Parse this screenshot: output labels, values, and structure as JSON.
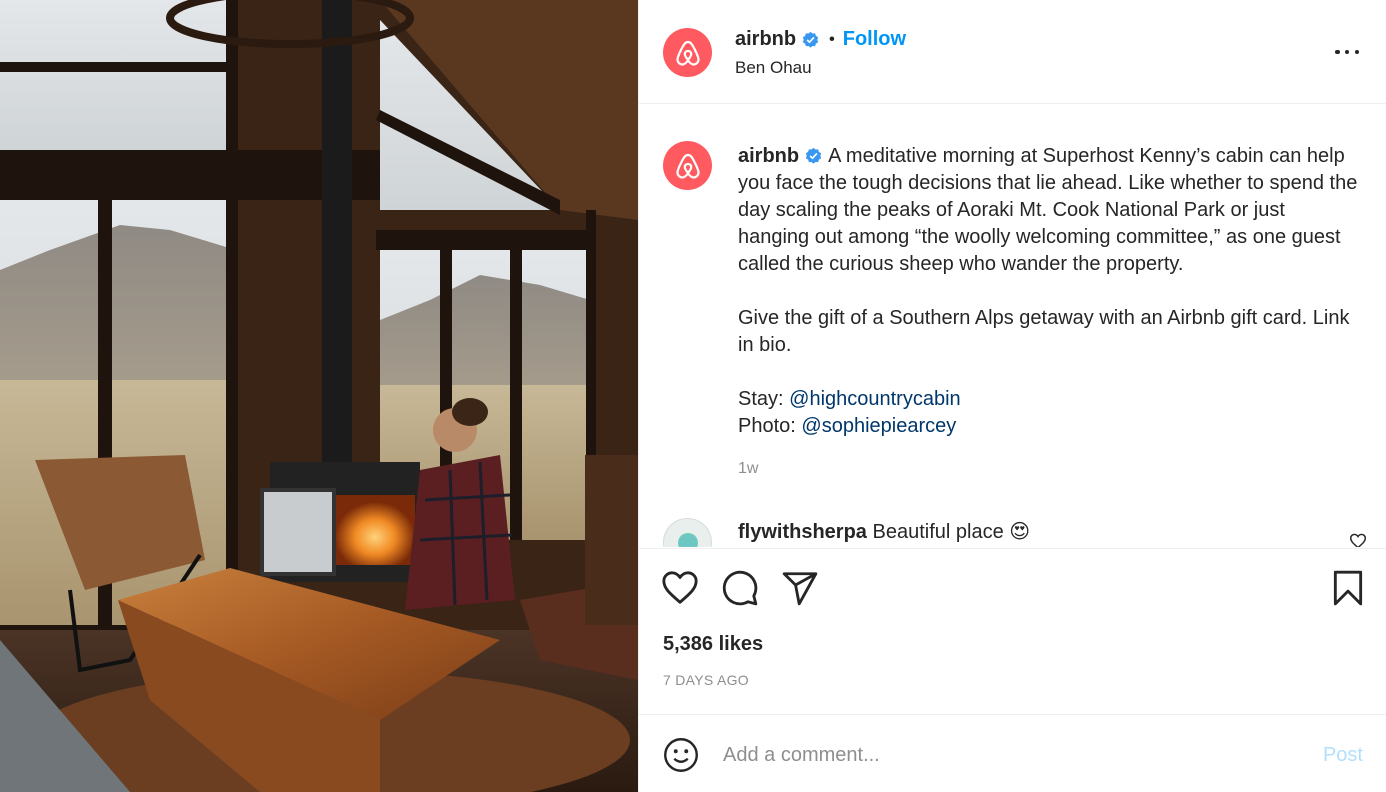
{
  "photo": {
    "alt_icon": "cabin-photo",
    "palette": {
      "wall": "#3a2416",
      "sky": "#d9dde0",
      "mountain": "#9a938a",
      "field": "#b9a888",
      "fire": "#f08a24",
      "table": "#b5662c",
      "rug": "#5a2e1f"
    }
  },
  "header": {
    "username": "airbnb",
    "separator": "•",
    "follow_label": "Follow",
    "location": "Ben Ohau",
    "more_icon": "more-horizontal-icon"
  },
  "caption": {
    "username": "airbnb",
    "text_1": "A meditative morning at Superhost Kenny’s cabin can help you face the tough decisions that lie ahead. Like whether to spend the day scaling the peaks of Aoraki Mt. Cook National Park or just hanging out among “the woolly welcoming committee,” as one guest called the curious sheep who wander the property.",
    "text_2": "Give the gift of a Southern Alps getaway with an Airbnb gift card. Link in bio.",
    "stay_label": "Stay: ",
    "stay_mention": "@highcountrycabin",
    "photo_label": "Photo: ",
    "photo_mention": "@sophiepiearcey",
    "age": "1w"
  },
  "comment": {
    "username": "flywithsherpa",
    "text": "Beautiful place 😍"
  },
  "actions": {
    "like_icon": "heart-icon",
    "comment_icon": "comment-icon",
    "share_icon": "share-icon",
    "save_icon": "bookmark-icon",
    "likes": "5,386 likes",
    "date": "7 DAYS AGO"
  },
  "add_comment": {
    "placeholder": "Add a comment...",
    "post_label": "Post"
  },
  "colors": {
    "brand": "#ff5a5f",
    "link": "#0095f6",
    "mention": "#00376b",
    "muted": "#8e8e8e",
    "post_disabled": "#b2dffc"
  }
}
